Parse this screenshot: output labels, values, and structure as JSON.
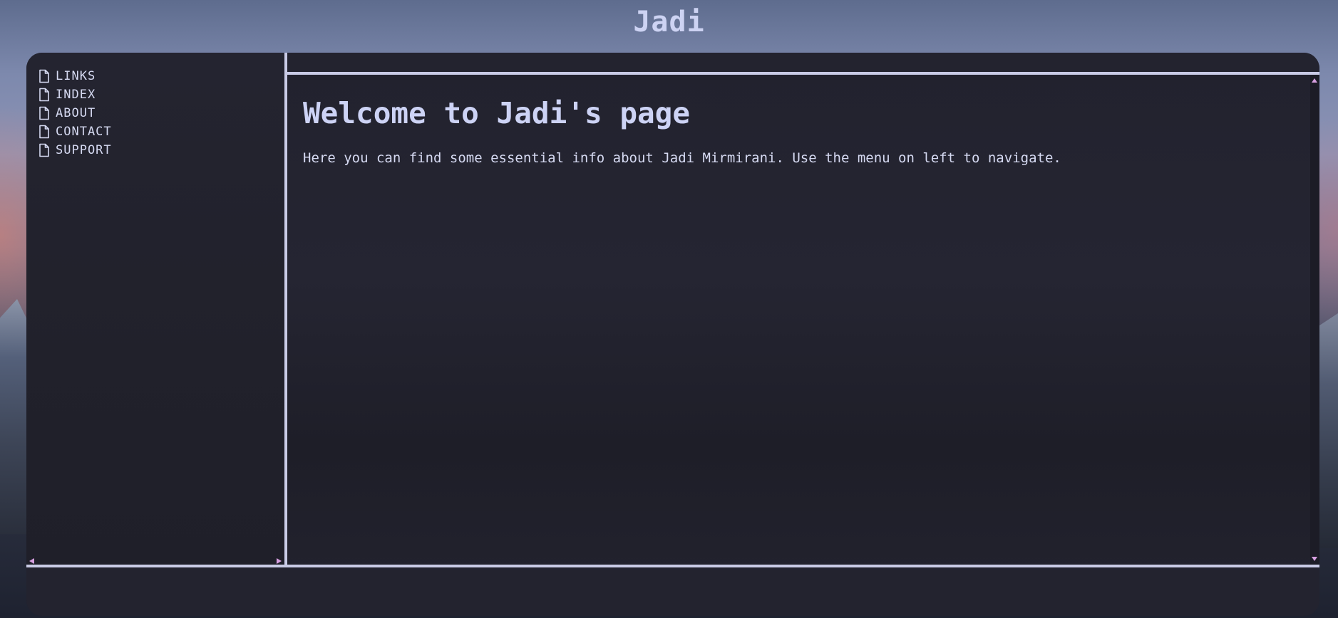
{
  "site": {
    "title": "Jadi"
  },
  "sidebar": {
    "items": [
      {
        "label": "LINKS",
        "icon": "file-icon"
      },
      {
        "label": "INDEX",
        "icon": "file-icon"
      },
      {
        "label": "ABOUT",
        "icon": "file-icon"
      },
      {
        "label": "CONTACT",
        "icon": "file-icon"
      },
      {
        "label": "SUPPORT",
        "icon": "file-icon"
      }
    ]
  },
  "main": {
    "heading": "Welcome to Jadi's page",
    "body": "Here you can find some essential info about Jadi Mirmirani. Use the menu on left to navigate."
  },
  "colors": {
    "accent": "#c9cbe6",
    "text": "#d6daf2",
    "heading": "#cdd3f5",
    "scroll_arrow": "#d79fe0",
    "panel": "#23232f"
  }
}
